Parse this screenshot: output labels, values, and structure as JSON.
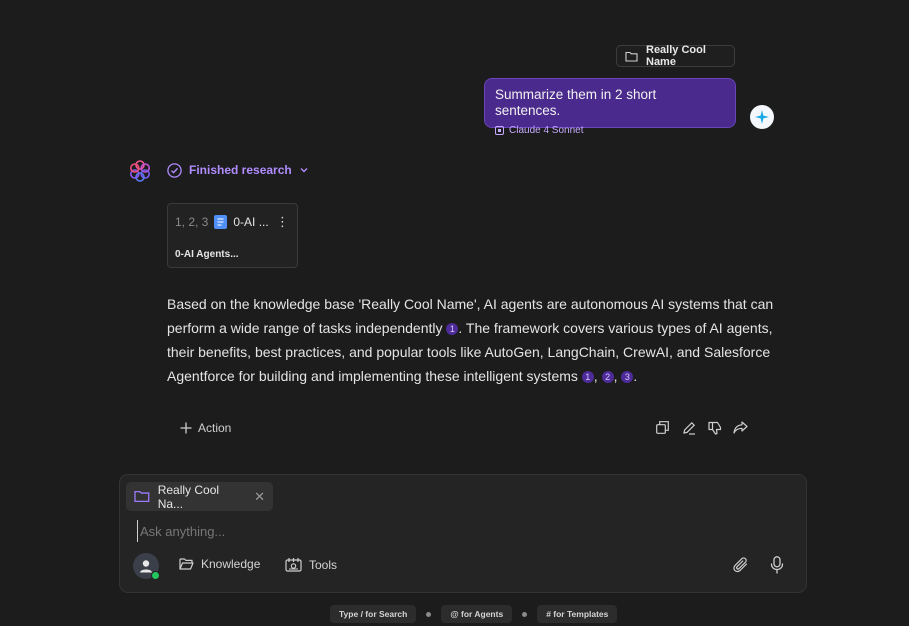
{
  "thread": {
    "folder_label": "Really Cool Name",
    "user_message": "Summarize them in 2 short sentences.",
    "model_label": "Claude 4 Sonnet"
  },
  "assistant": {
    "status": "Finished research",
    "source_card": {
      "numbers": "1, 2, 3",
      "doc_short": "0-AI ...",
      "title": "0-AI Agents..."
    },
    "answer": {
      "part1": "Based on the knowledge base 'Really Cool Name', AI agents are autonomous AI systems that can perform a wide range of tasks independently ",
      "cite_a": "1",
      "part2": ". The framework covers various types of AI agents, their benefits, best practices, and popular tools like AutoGen, LangChain, CrewAI, and Salesforce Agentforce for building and implementing these intelligent systems ",
      "cite_b": "1",
      "cite_c": "2",
      "cite_d": "3",
      "part3": "."
    },
    "action_label": "Action"
  },
  "composer": {
    "attachment_label": "Really Cool Na...",
    "placeholder": "Ask anything...",
    "knowledge_label": "Knowledge",
    "tools_label": "Tools"
  },
  "hints": [
    "Type / for Search",
    "@ for Agents",
    "# for Templates"
  ],
  "colors": {
    "accent": "#b08cff",
    "bubble": "#4a2a8c",
    "background": "#1c1c1c"
  }
}
